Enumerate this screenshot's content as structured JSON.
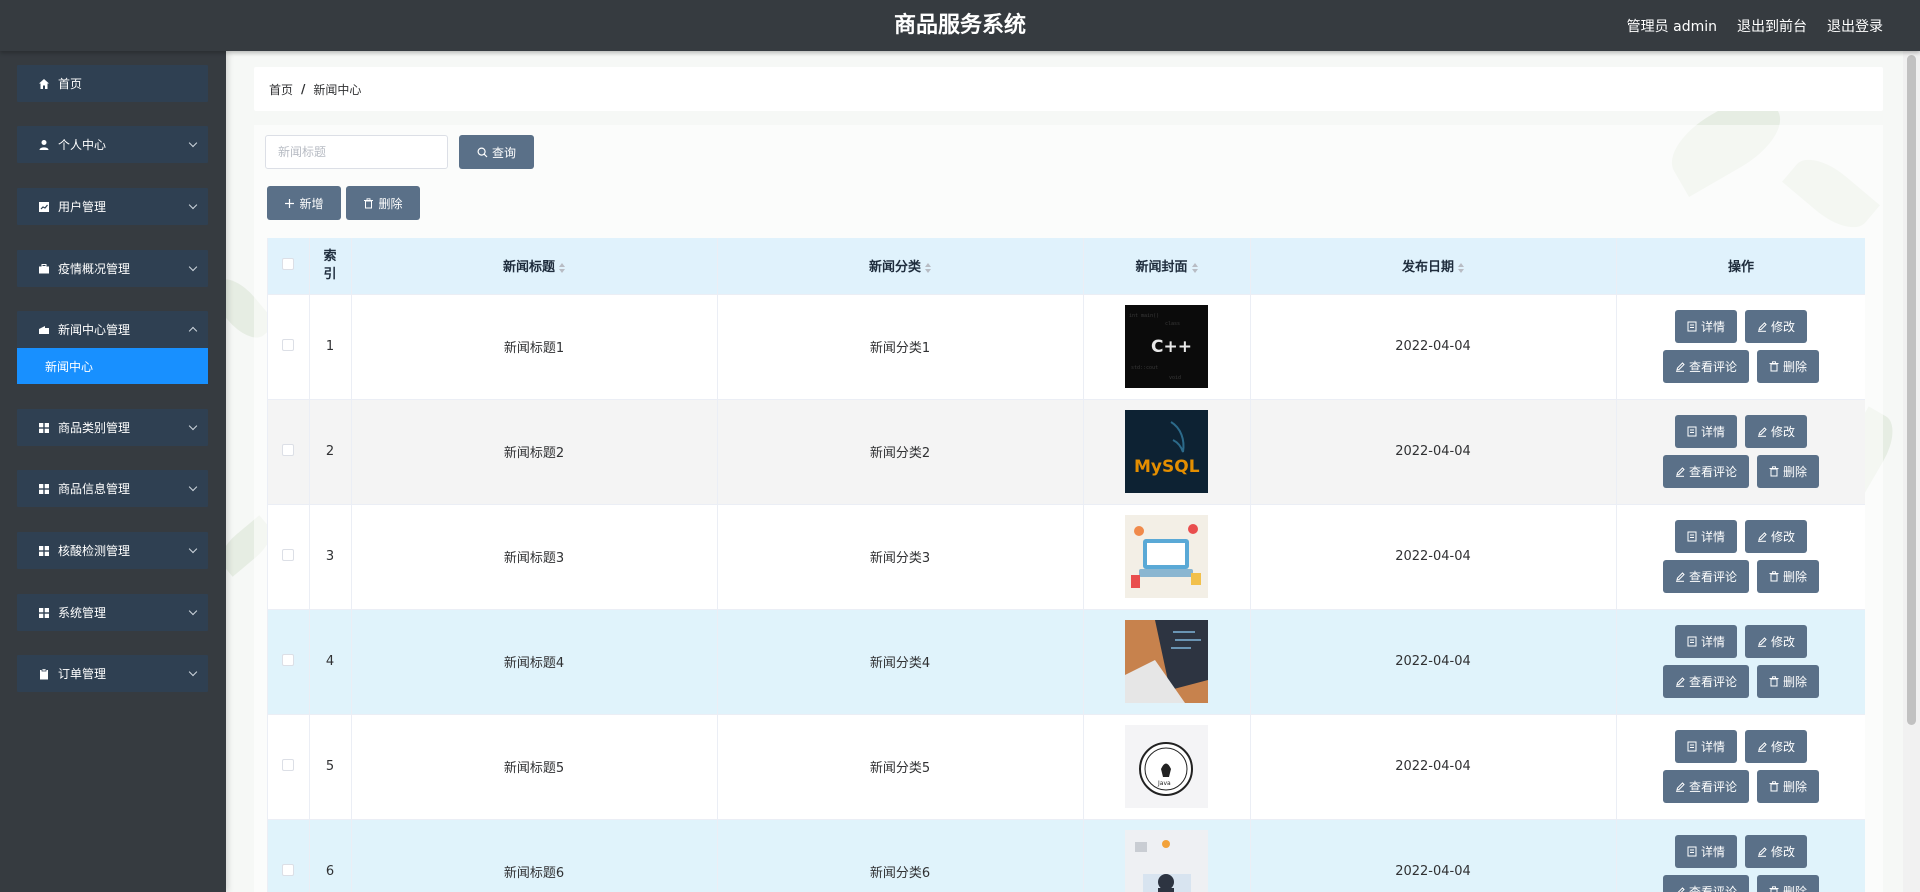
{
  "header": {
    "title": "商品服务系统",
    "user_label": "管理员 admin",
    "to_front_label": "退出到前台",
    "logout_label": "退出登录"
  },
  "sidebar": {
    "items": [
      {
        "label": "首页",
        "icon": "home-icon"
      },
      {
        "label": "个人中心",
        "icon": "user-icon"
      },
      {
        "label": "用户管理",
        "icon": "chart-icon"
      },
      {
        "label": "疫情概况管理",
        "icon": "briefcase-icon"
      },
      {
        "label": "新闻中心管理",
        "icon": "news-icon"
      },
      {
        "label": "商品类别管理",
        "icon": "grid-icon"
      },
      {
        "label": "商品信息管理",
        "icon": "grid-icon"
      },
      {
        "label": "核酸检测管理",
        "icon": "grid-icon"
      },
      {
        "label": "系统管理",
        "icon": "grid-icon"
      },
      {
        "label": "订单管理",
        "icon": "clipboard-icon"
      }
    ],
    "active_sub": "新闻中心"
  },
  "breadcrumb": {
    "home": "首页",
    "separator": "/",
    "current": "新闻中心"
  },
  "search": {
    "placeholder": "新闻标题",
    "value": "",
    "button_label": "查询"
  },
  "toolbar": {
    "add_label": "新增",
    "delete_label": "删除"
  },
  "table": {
    "columns": {
      "index": "索引",
      "title": "新闻标题",
      "category": "新闻分类",
      "cover": "新闻封面",
      "date": "发布日期",
      "actions": "操作"
    },
    "action_labels": {
      "detail": "详情",
      "edit": "修改",
      "comments": "查看评论",
      "delete": "删除"
    },
    "rows": [
      {
        "index": "1",
        "title": "新闻标题1",
        "category": "新闻分类1",
        "date": "2022-04-04",
        "cover": "cpp-cover"
      },
      {
        "index": "2",
        "title": "新闻标题2",
        "category": "新闻分类2",
        "date": "2022-04-04",
        "cover": "mysql-cover"
      },
      {
        "index": "3",
        "title": "新闻标题3",
        "category": "新闻分类3",
        "date": "2022-04-04",
        "cover": "desk-cover"
      },
      {
        "index": "4",
        "title": "新闻标题4",
        "category": "新闻分类4",
        "date": "2022-04-04",
        "cover": "laptop-cover"
      },
      {
        "index": "5",
        "title": "新闻标题5",
        "category": "新闻分类5",
        "date": "2022-04-04",
        "cover": "java-cover"
      },
      {
        "index": "6",
        "title": "新闻标题6",
        "category": "新闻分类6",
        "date": "2022-04-04",
        "cover": "worker-cover"
      }
    ]
  },
  "colors": {
    "header_bg": "#363b40",
    "menu_bg": "#2f4052",
    "active_sub_bg": "#1890ff",
    "button_bg": "#5a7088",
    "table_header_bg": "#e0f2fc"
  },
  "cover_text": {
    "cpp": "C++",
    "mysql": "MySQL",
    "java": "Java"
  }
}
